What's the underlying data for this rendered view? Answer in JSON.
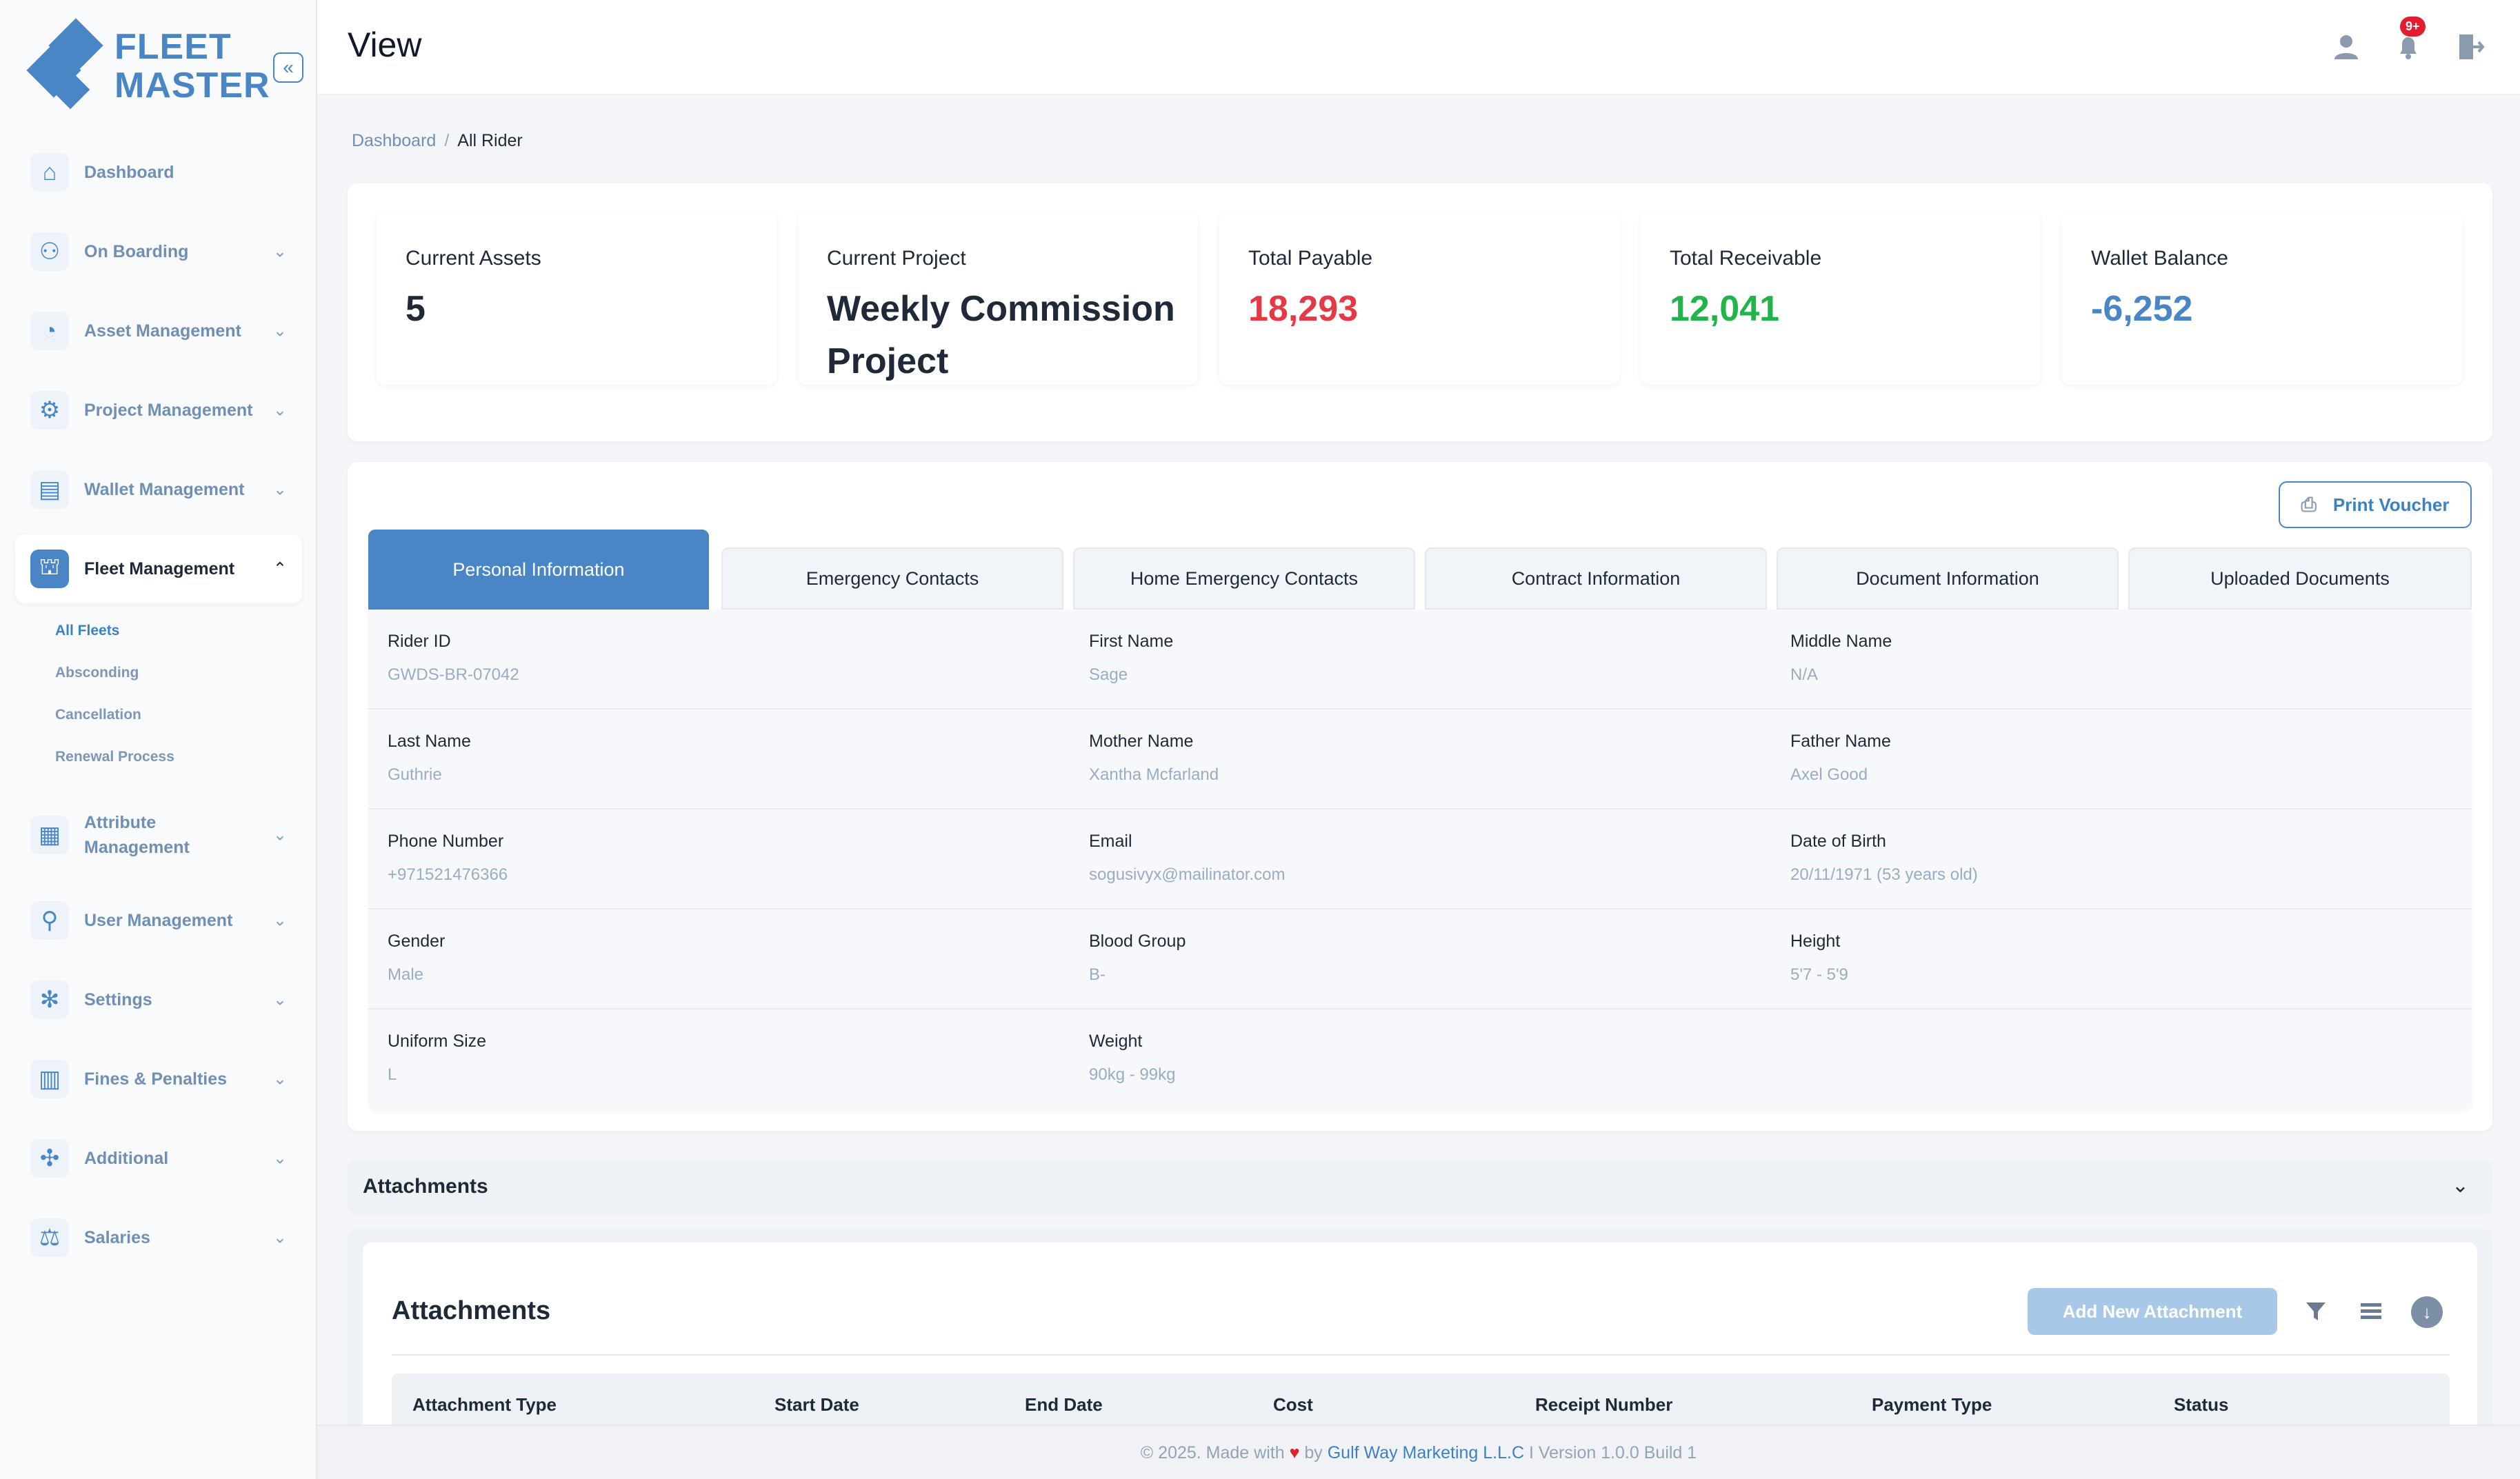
{
  "brand": {
    "line1": "FLEET",
    "line2": "MASTER",
    "collapse_icon": "double-chevron-left-icon"
  },
  "sidebar": {
    "items": [
      {
        "label": "Dashboard",
        "icon": "home-icon"
      },
      {
        "label": "On Boarding",
        "icon": "onboarding-icon"
      },
      {
        "label": "Asset Management",
        "icon": "asset-icon"
      },
      {
        "label": "Project Management",
        "icon": "project-icon"
      },
      {
        "label": "Wallet Management",
        "icon": "wallet-icon"
      },
      {
        "label": "Fleet Management",
        "icon": "fleet-icon"
      },
      {
        "label": "Attribute Management",
        "icon": "attribute-icon"
      },
      {
        "label": "User Management",
        "icon": "users-icon"
      },
      {
        "label": "Settings",
        "icon": "gear-icon"
      },
      {
        "label": "Fines & Penalties",
        "icon": "fines-icon"
      },
      {
        "label": "Additional",
        "icon": "additional-icon"
      },
      {
        "label": "Salaries",
        "icon": "salaries-icon"
      }
    ],
    "fleet_sub": [
      "All Fleets",
      "Absconding",
      "Cancellation",
      "Renewal Process"
    ]
  },
  "header": {
    "title": "View",
    "badge": "9+"
  },
  "breadcrumb": {
    "home": "Dashboard",
    "current": "All Rider"
  },
  "stats": [
    {
      "label": "Current Assets",
      "value": "5",
      "color": "#1f2937"
    },
    {
      "label": "Current Project",
      "value": "Weekly Commission Project",
      "color": "#1f2937"
    },
    {
      "label": "Total Payable",
      "value": "18,293",
      "color": "#e53945"
    },
    {
      "label": "Total Receivable",
      "value": "12,041",
      "color": "#1fb54a"
    },
    {
      "label": "Wallet Balance",
      "value": "-6,252",
      "color": "#4a86c5"
    }
  ],
  "print_label": "Print Voucher",
  "tabs": [
    "Personal Information",
    "Emergency Contacts",
    "Home Emergency Contacts",
    "Contract Information",
    "Document Information",
    "Uploaded Documents"
  ],
  "fields": [
    [
      {
        "k": "Rider ID",
        "v": "GWDS-BR-07042"
      },
      {
        "k": "First Name",
        "v": "Sage"
      },
      {
        "k": "Middle Name",
        "v": "N/A"
      }
    ],
    [
      {
        "k": "Last Name",
        "v": "Guthrie"
      },
      {
        "k": "Mother Name",
        "v": "Xantha Mcfarland"
      },
      {
        "k": "Father Name",
        "v": "Axel Good"
      }
    ],
    [
      {
        "k": "Phone Number",
        "v": "+971521476366"
      },
      {
        "k": "Email",
        "v": "sogusivyx@mailinator.com"
      },
      {
        "k": "Date of Birth",
        "v": "20/11/1971 (53 years old)"
      }
    ],
    [
      {
        "k": "Gender",
        "v": "Male"
      },
      {
        "k": "Blood Group",
        "v": "B-"
      },
      {
        "k": "Height",
        "v": "5'7 - 5'9"
      }
    ],
    [
      {
        "k": "Uniform Size",
        "v": "L"
      },
      {
        "k": "Weight",
        "v": "90kg - 99kg"
      }
    ]
  ],
  "attachments": {
    "bar_title": "Attachments",
    "title": "Attachments",
    "add_label": "Add New Attachment",
    "columns": [
      "Attachment Type",
      "Start Date",
      "End Date",
      "Cost",
      "Receipt Number",
      "Payment Type",
      "Status"
    ]
  },
  "footer": {
    "prefix": "© 2025. Made with",
    "by": "by",
    "company": "Gulf Way Marketing L.L.C",
    "suffix": "I Version 1.0.0 Build 1"
  }
}
